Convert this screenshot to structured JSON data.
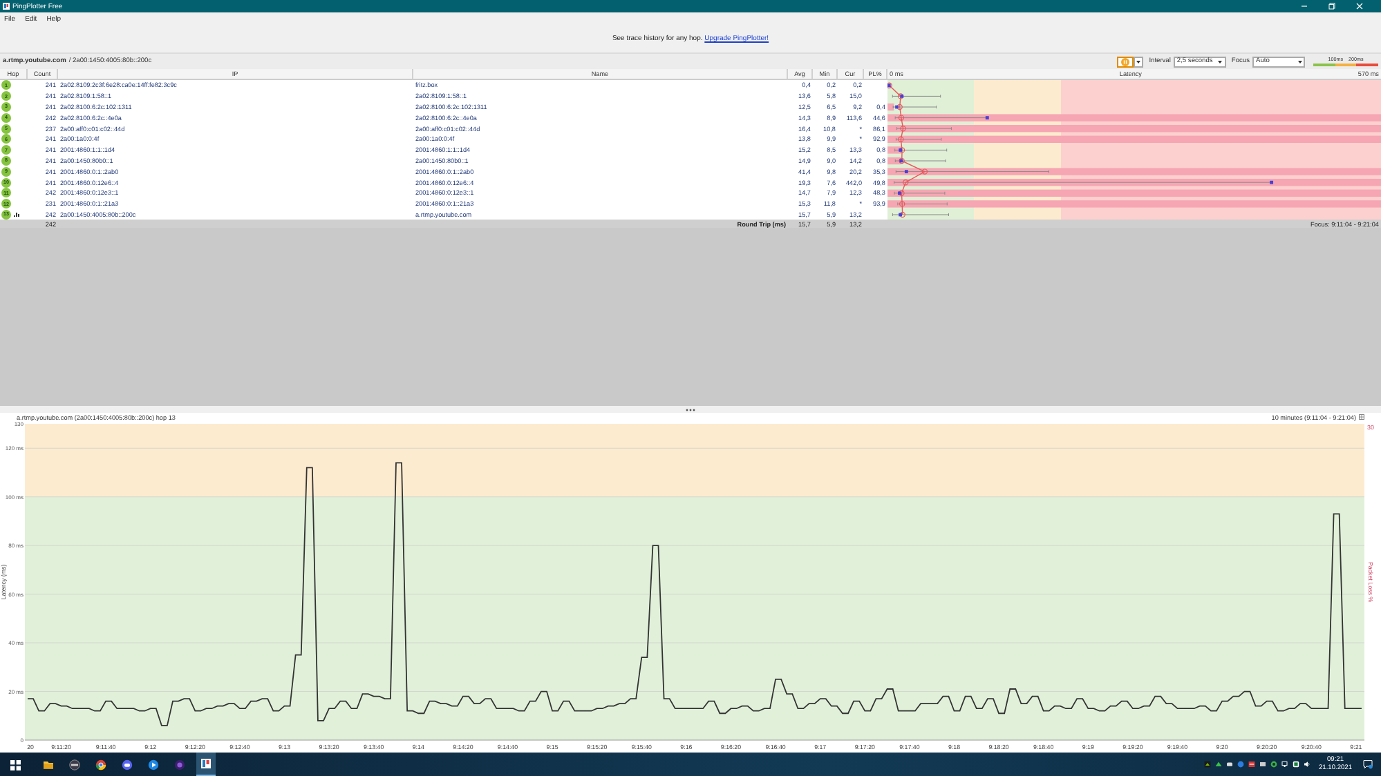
{
  "window": {
    "title": "PingPlotter Free"
  },
  "menu": [
    "File",
    "Edit",
    "Help"
  ],
  "banner": {
    "text": "See trace history for any hop.",
    "link": "Upgrade PingPlotter!"
  },
  "target": {
    "host": "a.rtmp.youtube.com",
    "address": "/ 2a00:1450:4005:80b::200c"
  },
  "controls": {
    "paused": true,
    "interval_label": "Interval",
    "interval": "2,5 seconds",
    "focus_label": "Focus",
    "focus": "Auto",
    "legend": [
      "100ms",
      "200ms"
    ]
  },
  "trace": {
    "columns": [
      "Hop",
      "Count",
      "IP",
      "Name",
      "Avg",
      "Min",
      "Cur",
      "PL%"
    ],
    "latency_header": {
      "min": "0 ms",
      "title": "Latency",
      "max": "570 ms"
    },
    "rows": [
      {
        "hop": "1",
        "count": "241",
        "ip": "2a02:8109:2c3f:6e28:ca0e:14ff:fe82:3c9c",
        "name": "fritz.box",
        "avg": "0,4",
        "min": "0,2",
        "cur": "0,2",
        "level": 0,
        "graphed": false
      },
      {
        "hop": "2",
        "count": "241",
        "ip": "2a02:8109:1:58::1",
        "name": "2a02:8109:1:58::1",
        "avg": "13,6",
        "min": "5,8",
        "cur": "15,0",
        "level": 0,
        "graphed": false
      },
      {
        "hop": "3",
        "count": "241",
        "ip": "2a02:8100:6:2c:102:1311",
        "name": "2a02:8100:6:2c:102:1311",
        "avg": "12,5",
        "min": "6,5",
        "cur": "9,2",
        "pl": "0,4",
        "level": 0.013,
        "graphed": false
      },
      {
        "hop": "4",
        "count": "242",
        "ip": "2a02:8100:6:2c::4e0a",
        "name": "2a02:8100:6:2c::4e0a",
        "avg": "14,3",
        "min": "8,9",
        "cur": "113,6",
        "pl": "44,6",
        "level": 1,
        "graphed": false
      },
      {
        "hop": "5",
        "count": "237",
        "ip": "2a00:aff0:c01:c02::44d",
        "name": "2a00:aff0:c01:c02::44d",
        "avg": "16,4",
        "min": "10,8",
        "cur": "*",
        "pl": "86,1",
        "level": 1,
        "graphed": false
      },
      {
        "hop": "6",
        "count": "241",
        "ip": "2a00:1a0:0:4f",
        "name": "2a00:1a0:0:4f",
        "avg": "13,8",
        "min": "9,9",
        "cur": "*",
        "pl": "92,9",
        "level": 1,
        "graphed": false
      },
      {
        "hop": "7",
        "count": "241",
        "ip": "2001:4860:1:1::1d4",
        "name": "2001:4860:1:1::1d4",
        "avg": "15,2",
        "min": "8,5",
        "cur": "13,3",
        "pl": "0,8",
        "level": 0.027,
        "graphed": false
      },
      {
        "hop": "8",
        "count": "241",
        "ip": "2a00:1450:80b0::1",
        "name": "2a00:1450:80b0::1",
        "avg": "14,9",
        "min": "9,0",
        "cur": "14,2",
        "pl": "0,8",
        "level": 0.027,
        "graphed": false
      },
      {
        "hop": "9",
        "count": "241",
        "ip": "2001:4860:0:1::2ab0",
        "name": "2001:4860:0:1::2ab0",
        "avg": "41,4",
        "min": "9,8",
        "cur": "20,2",
        "pl": "35,3",
        "level": 1,
        "graphed": false
      },
      {
        "hop": "10",
        "count": "241",
        "ip": "2001:4860:0:12e6::4",
        "name": "2001:4860:0:12e6::4",
        "avg": "19,3",
        "min": "7,6",
        "cur": "442,0",
        "pl": "49,8",
        "level": 1,
        "graphed": false
      },
      {
        "hop": "11",
        "count": "242",
        "ip": "2001:4860:0:12e3::1",
        "name": "2001:4860:0:12e3::1",
        "avg": "14,7",
        "min": "7,9",
        "cur": "12,3",
        "pl": "48,3",
        "level": 1,
        "graphed": false
      },
      {
        "hop": "12",
        "count": "231",
        "ip": "2001:4860:0:1::21a3",
        "name": "2001:4860:0:1::21a3",
        "avg": "15,3",
        "min": "11,8",
        "cur": "*",
        "pl": "93,9",
        "level": 1,
        "graphed": false
      },
      {
        "hop": "13",
        "count": "242",
        "ip": "2a00:1450:4005:80b::200c",
        "name": "a.rtmp.youtube.com",
        "avg": "15,7",
        "min": "5,9",
        "cur": "13,2",
        "level": 0,
        "graphed": true
      }
    ],
    "summary": {
      "count": "242",
      "label": "Round Trip (ms)",
      "avg": "15,7",
      "min": "5,9",
      "cur": "13,2",
      "focus": "Focus: 9:11:04 - 9:21:04"
    }
  },
  "timeline": {
    "title": "a.rtmp.youtube.com (2a00:1450:4005:80b::200c) hop 13",
    "range": "10 minutes (9:11:04 - 9:21:04)",
    "loss_label": "Packet Loss %",
    "loss_max": "30",
    "chart_data": {
      "type": "line",
      "ylabel": "Latency (ms)",
      "ylim": [
        0,
        130
      ],
      "grid": true,
      "bands": [
        {
          "axis": "y",
          "from": 100,
          "to": 130,
          "color": "#fdebd0"
        },
        {
          "axis": "y",
          "from": 0,
          "to": 100,
          "color": "#e1f0d9"
        }
      ],
      "yticks": [
        {
          "value": 0,
          "label": "0"
        },
        {
          "value": 20,
          "label": "20 ms"
        },
        {
          "value": 40,
          "label": "40 ms"
        },
        {
          "value": 60,
          "label": "60 ms"
        },
        {
          "value": 80,
          "label": "80 ms"
        },
        {
          "value": 100,
          "label": "100 ms"
        },
        {
          "value": 120,
          "label": "120 ms"
        },
        {
          "value": 130,
          "label": "130"
        }
      ],
      "categories": [
        "20",
        null,
        null,
        null,
        null,
        null,
        "9:11:20",
        null,
        null,
        null,
        null,
        null,
        null,
        null,
        "9:11:40",
        null,
        null,
        null,
        null,
        null,
        null,
        null,
        "9:12",
        null,
        null,
        null,
        null,
        null,
        null,
        null,
        "9:12:20",
        null,
        null,
        null,
        null,
        null,
        null,
        null,
        "9:12:40",
        null,
        null,
        null,
        null,
        null,
        null,
        null,
        "9:13",
        null,
        null,
        null,
        null,
        null,
        null,
        null,
        "9:13:20",
        null,
        null,
        null,
        null,
        null,
        null,
        null,
        "9:13:40",
        null,
        null,
        null,
        null,
        null,
        null,
        null,
        "9:14",
        null,
        null,
        null,
        null,
        null,
        null,
        null,
        "9:14:20",
        null,
        null,
        null,
        null,
        null,
        null,
        null,
        "9:14:40",
        null,
        null,
        null,
        null,
        null,
        null,
        null,
        "9:15",
        null,
        null,
        null,
        null,
        null,
        null,
        null,
        "9:15:20",
        null,
        null,
        null,
        null,
        null,
        null,
        null,
        "9:15:40",
        null,
        null,
        null,
        null,
        null,
        null,
        null,
        "9:16",
        null,
        null,
        null,
        null,
        null,
        null,
        null,
        "9:16:20",
        null,
        null,
        null,
        null,
        null,
        null,
        null,
        "9:16:40",
        null,
        null,
        null,
        null,
        null,
        null,
        null,
        "9:17",
        null,
        null,
        null,
        null,
        null,
        null,
        null,
        "9:17:20",
        null,
        null,
        null,
        null,
        null,
        null,
        null,
        "9:17:40",
        null,
        null,
        null,
        null,
        null,
        null,
        null,
        "9:18",
        null,
        null,
        null,
        null,
        null,
        null,
        null,
        "9:18:20",
        null,
        null,
        null,
        null,
        null,
        null,
        null,
        "9:18:40",
        null,
        null,
        null,
        null,
        null,
        null,
        null,
        "9:19",
        null,
        null,
        null,
        null,
        null,
        null,
        null,
        "9:19:20",
        null,
        null,
        null,
        null,
        null,
        null,
        null,
        "9:19:40",
        null,
        null,
        null,
        null,
        null,
        null,
        null,
        "9:20",
        null,
        null,
        null,
        null,
        null,
        null,
        null,
        "9:20:20",
        null,
        null,
        null,
        null,
        null,
        null,
        null,
        "9:20:40",
        null,
        null,
        null,
        null,
        null,
        null,
        null,
        "9:21",
        null
      ],
      "series": [
        {
          "color": "#333333",
          "values": [
            17,
            17,
            12,
            12,
            15,
            15,
            14,
            14,
            13,
            13,
            13,
            13,
            12,
            12,
            16,
            16,
            13,
            13,
            13,
            13,
            12,
            12,
            13,
            13,
            6,
            6,
            16,
            16,
            17,
            17,
            12,
            12,
            13,
            13,
            14,
            14,
            15,
            15,
            13,
            13,
            16,
            16,
            17,
            17,
            12,
            12,
            14,
            14,
            35,
            35,
            112,
            112,
            8,
            8,
            13,
            13,
            16,
            16,
            13,
            13,
            19,
            19,
            18,
            18,
            17,
            17,
            114,
            114,
            12,
            12,
            11,
            11,
            16,
            16,
            15,
            15,
            14,
            14,
            18,
            18,
            15,
            15,
            17,
            17,
            13,
            13,
            13,
            13,
            12,
            12,
            16,
            16,
            20,
            20,
            12,
            12,
            16,
            16,
            12,
            12,
            12,
            12,
            13,
            13,
            14,
            14,
            15,
            15,
            17,
            17,
            34,
            34,
            80,
            80,
            17,
            17,
            13,
            13,
            13,
            13,
            13,
            13,
            16,
            16,
            11,
            11,
            13,
            13,
            14,
            14,
            12,
            12,
            13,
            13,
            25,
            25,
            19,
            19,
            13,
            13,
            15,
            15,
            17,
            17,
            14,
            14,
            11,
            11,
            16,
            16,
            12,
            12,
            17,
            17,
            21,
            21,
            12,
            12,
            12,
            12,
            15,
            15,
            15,
            15,
            18,
            18,
            12,
            12,
            18,
            18,
            13,
            13,
            17,
            17,
            11,
            11,
            21,
            21,
            15,
            15,
            18,
            18,
            12,
            12,
            14,
            14,
            13,
            13,
            17,
            17,
            13,
            13,
            12,
            12,
            14,
            14,
            16,
            16,
            13,
            13,
            14,
            14,
            18,
            18,
            15,
            15,
            13,
            13,
            13,
            13,
            14,
            14,
            12,
            12,
            16,
            16,
            18,
            18,
            20,
            20,
            14,
            14,
            16,
            16,
            12,
            12,
            13,
            13,
            15,
            15,
            13,
            13,
            13,
            13,
            93,
            93,
            13,
            13,
            13,
            13
          ]
        }
      ]
    }
  },
  "taskbar": {
    "time": "09:21",
    "date": "21.10.2021"
  }
}
